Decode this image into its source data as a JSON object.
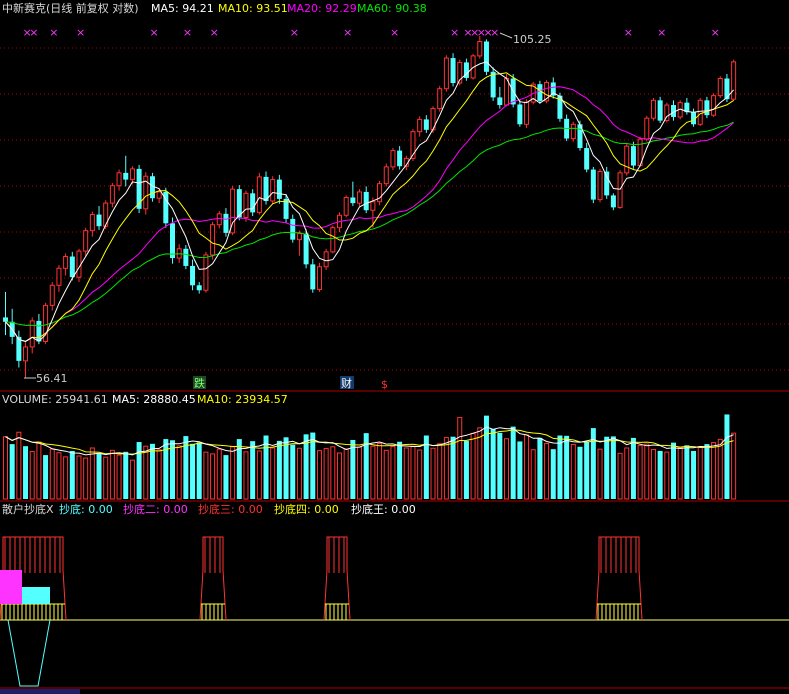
{
  "price_header": {
    "title": "中新赛克(日线 前复权 对数)",
    "ma5_label": "MA5: 94.21",
    "ma10_label": "MA10: 93.51",
    "ma20_label": "MA20: 92.29",
    "ma60_label": "MA60: 90.38"
  },
  "annotations": {
    "high_label": "105.25",
    "low_label": "56.41",
    "marker_die": "跌",
    "marker_cai": "财",
    "marker_dollar": "$"
  },
  "volume_header": {
    "volume_label": "VOLUME: 25941.61",
    "ma5_label": "MA5: 28880.45",
    "ma10_label": "MA10: 23934.57"
  },
  "indicator_header": {
    "name": "散户抄底X",
    "v1": "抄底: 0.00",
    "v2": "抄底二: 0.00",
    "v3": "抄底三: 0.00",
    "v4": "抄底四: 0.00",
    "v5": "抄底王: 0.00"
  },
  "colors": {
    "background": "#000000",
    "up": "#ff3232",
    "down": "#54ffff",
    "ma5": "#ffffff",
    "ma10": "#ffff00",
    "ma20": "#ff00ff",
    "ma60": "#00e600",
    "grid": "#b00000",
    "magenta_marker": "#ff33ff"
  },
  "chart_data": [
    {
      "type": "candlestick",
      "title": "中新赛克(日线 前复权 对数)",
      "ylim": [
        56.41,
        105.25
      ],
      "high": 105.25,
      "low": 56.41,
      "ohlc": [
        [
          63.0,
          66.0,
          61.0,
          62.5
        ],
        [
          62.5,
          64.0,
          60.0,
          60.8
        ],
        [
          60.8,
          61.5,
          57.5,
          58.2
        ],
        [
          58.2,
          60.2,
          56.4,
          59.7
        ],
        [
          59.7,
          63.0,
          59.0,
          62.6
        ],
        [
          62.6,
          63.4,
          60.0,
          60.3
        ],
        [
          60.3,
          64.7,
          60.0,
          64.4
        ],
        [
          64.4,
          67.2,
          63.8,
          66.8
        ],
        [
          66.8,
          69.3,
          66.0,
          68.9
        ],
        [
          68.9,
          70.8,
          68.0,
          70.4
        ],
        [
          70.4,
          71.0,
          67.4,
          67.8
        ],
        [
          67.8,
          71.4,
          67.2,
          71.1
        ],
        [
          71.1,
          74.2,
          70.5,
          73.8
        ],
        [
          73.8,
          76.4,
          73.0,
          76.0
        ],
        [
          76.0,
          77.2,
          73.9,
          74.4
        ],
        [
          74.4,
          78.0,
          74.0,
          77.6
        ],
        [
          77.6,
          80.5,
          77.0,
          80.1
        ],
        [
          80.1,
          82.5,
          79.4,
          82.0
        ],
        [
          82.0,
          84.6,
          80.0,
          81.0
        ],
        [
          81.0,
          83.0,
          80.3,
          82.6
        ],
        [
          82.6,
          83.2,
          76.2,
          76.8
        ],
        [
          76.8,
          82.1,
          76.0,
          81.5
        ],
        [
          81.5,
          82.0,
          77.8,
          78.3
        ],
        [
          78.3,
          79.6,
          77.6,
          79.2
        ],
        [
          79.2,
          79.8,
          74.2,
          74.8
        ],
        [
          74.8,
          75.6,
          69.5,
          70.2
        ],
        [
          70.2,
          72.0,
          69.6,
          71.4
        ],
        [
          71.4,
          71.9,
          68.8,
          69.2
        ],
        [
          69.2,
          70.0,
          66.2,
          66.8
        ],
        [
          66.8,
          67.2,
          65.8,
          66.2
        ],
        [
          66.2,
          71.0,
          65.9,
          70.6
        ],
        [
          70.6,
          75.0,
          70.0,
          74.6
        ],
        [
          74.6,
          76.5,
          74.1,
          76.1
        ],
        [
          76.1,
          76.9,
          73.0,
          73.5
        ],
        [
          73.5,
          80.1,
          73.2,
          79.6
        ],
        [
          79.6,
          80.2,
          75.2,
          75.6
        ],
        [
          75.6,
          79.4,
          75.0,
          79.0
        ],
        [
          79.0,
          79.6,
          75.8,
          76.3
        ],
        [
          76.3,
          82.0,
          76.0,
          81.4
        ],
        [
          81.4,
          82.2,
          77.4,
          77.9
        ],
        [
          77.9,
          81.5,
          77.5,
          81.0
        ],
        [
          81.0,
          81.7,
          77.5,
          78.2
        ],
        [
          78.2,
          78.9,
          74.9,
          75.4
        ],
        [
          75.4,
          76.0,
          72.2,
          72.6
        ],
        [
          72.6,
          73.8,
          70.5,
          73.4
        ],
        [
          73.4,
          74.0,
          68.9,
          69.4
        ],
        [
          69.4,
          70.1,
          65.9,
          66.3
        ],
        [
          66.3,
          69.6,
          66.0,
          69.1
        ],
        [
          69.1,
          71.4,
          68.7,
          71.0
        ],
        [
          71.0,
          74.5,
          70.8,
          74.2
        ],
        [
          74.2,
          76.3,
          73.6,
          75.9
        ],
        [
          75.9,
          78.7,
          75.6,
          78.4
        ],
        [
          78.4,
          80.7,
          77.2,
          77.6
        ],
        [
          77.6,
          79.6,
          77.2,
          79.2
        ],
        [
          79.2,
          80.0,
          76.2,
          76.6
        ],
        [
          76.6,
          78.4,
          74.2,
          77.8
        ],
        [
          77.8,
          80.8,
          77.3,
          80.4
        ],
        [
          80.4,
          83.4,
          80.0,
          82.9
        ],
        [
          82.9,
          85.8,
          82.4,
          85.4
        ],
        [
          85.4,
          86.1,
          82.5,
          83.0
        ],
        [
          83.0,
          84.6,
          82.4,
          84.2
        ],
        [
          84.2,
          88.8,
          83.8,
          88.4
        ],
        [
          88.4,
          90.9,
          87.6,
          90.4
        ],
        [
          90.4,
          91.1,
          88.2,
          88.7
        ],
        [
          88.7,
          92.6,
          88.2,
          92.2
        ],
        [
          92.2,
          96.1,
          91.7,
          95.6
        ],
        [
          95.6,
          101.6,
          95.1,
          101.1
        ],
        [
          101.1,
          102.0,
          96.0,
          96.6
        ],
        [
          96.6,
          100.8,
          96.2,
          100.3
        ],
        [
          100.3,
          101.0,
          97.0,
          97.5
        ],
        [
          97.5,
          101.9,
          97.2,
          101.5
        ],
        [
          101.5,
          105.25,
          101.0,
          104.2
        ],
        [
          104.2,
          104.6,
          98.0,
          98.6
        ],
        [
          98.6,
          99.4,
          93.5,
          94.1
        ],
        [
          94.1,
          95.9,
          92.2,
          92.8
        ],
        [
          92.8,
          98.2,
          92.6,
          97.4
        ],
        [
          97.4,
          98.2,
          92.4,
          92.9
        ],
        [
          92.9,
          93.6,
          89.2,
          89.6
        ],
        [
          89.6,
          93.8,
          89.0,
          93.3
        ],
        [
          93.3,
          96.8,
          92.9,
          96.4
        ],
        [
          96.4,
          97.0,
          93.0,
          93.5
        ],
        [
          93.5,
          97.1,
          93.1,
          96.7
        ],
        [
          96.7,
          97.6,
          93.9,
          94.4
        ],
        [
          94.4,
          94.9,
          90.0,
          90.5
        ],
        [
          90.5,
          91.2,
          86.9,
          87.3
        ],
        [
          87.3,
          90.0,
          86.8,
          89.6
        ],
        [
          89.6,
          90.2,
          85.4,
          85.8
        ],
        [
          85.8,
          86.6,
          82.1,
          82.5
        ],
        [
          82.5,
          82.9,
          77.6,
          78.1
        ],
        [
          78.1,
          82.6,
          77.7,
          82.2
        ],
        [
          82.2,
          82.9,
          78.2,
          78.7
        ],
        [
          78.7,
          79.0,
          76.6,
          77.0
        ],
        [
          77.0,
          82.4,
          76.8,
          82.0
        ],
        [
          82.0,
          86.6,
          81.6,
          86.1
        ],
        [
          86.1,
          86.8,
          82.6,
          83.1
        ],
        [
          83.1,
          87.6,
          82.9,
          87.2
        ],
        [
          87.2,
          91.0,
          86.8,
          90.6
        ],
        [
          90.6,
          94.0,
          90.2,
          93.6
        ],
        [
          93.6,
          94.2,
          89.8,
          90.2
        ],
        [
          90.2,
          93.2,
          89.9,
          92.8
        ],
        [
          92.8,
          93.6,
          90.2,
          90.8
        ],
        [
          90.8,
          93.6,
          90.4,
          93.2
        ],
        [
          93.2,
          94.0,
          91.2,
          91.6
        ],
        [
          91.6,
          92.2,
          89.2,
          89.6
        ],
        [
          89.6,
          94.0,
          89.3,
          93.6
        ],
        [
          93.6,
          94.2,
          90.6,
          91.1
        ],
        [
          91.1,
          94.8,
          90.8,
          94.4
        ],
        [
          94.4,
          97.8,
          94.0,
          97.4
        ],
        [
          97.4,
          98.2,
          93.3,
          93.8
        ],
        [
          93.8,
          100.8,
          93.5,
          100.4
        ]
      ],
      "ma_values": {
        "MA5": 94.21,
        "MA10": 93.51,
        "MA20": 92.29,
        "MA60": 90.38
      },
      "markers": [
        "跌",
        "财",
        "$"
      ]
    },
    {
      "type": "bar",
      "name": "VOLUME",
      "latest": 25941.61,
      "ma5": 28880.45,
      "ma10": 23934.57,
      "values": [
        21000,
        18500,
        22500,
        17800,
        16000,
        19200,
        14800,
        16800,
        15600,
        14200,
        16200,
        14500,
        13800,
        17200,
        15300,
        14100,
        16400,
        14800,
        15900,
        13100,
        19200,
        17800,
        18600,
        16600,
        20200,
        19800,
        17900,
        21200,
        18600,
        19100,
        15800,
        15200,
        16800,
        14800,
        17600,
        20200,
        15900,
        19500,
        16200,
        21400,
        17200,
        19600,
        20800,
        18300,
        17100,
        21800,
        22400,
        16300,
        17000,
        17600,
        15500,
        16900,
        19900,
        17500,
        22200,
        17800,
        18700,
        16400,
        17700,
        19300,
        17200,
        17800,
        16500,
        21400,
        17100,
        18600,
        20700,
        21000,
        27500,
        19600,
        22100,
        24000,
        28100,
        23600,
        22300,
        20300,
        24400,
        19400,
        21600,
        16600,
        20600,
        18700,
        16800,
        21400,
        21300,
        18400,
        17600,
        19300,
        23900,
        16800,
        21000,
        21100,
        15400,
        17200,
        20600,
        18000,
        18500,
        16700,
        16200,
        15800,
        19000,
        17400,
        18100,
        16200,
        17700,
        18500,
        19000,
        20100,
        28500,
        22200
      ],
      "up_flags": [
        1,
        0,
        1,
        0,
        1,
        1,
        0,
        1,
        1,
        1,
        0,
        1,
        1,
        1,
        0,
        1,
        1,
        1,
        0,
        1,
        0,
        1,
        0,
        1,
        0,
        0,
        1,
        0,
        0,
        0,
        1,
        1,
        1,
        0,
        1,
        0,
        1,
        0,
        1,
        0,
        1,
        0,
        0,
        0,
        1,
        0,
        0,
        1,
        1,
        1,
        1,
        1,
        0,
        1,
        0,
        1,
        1,
        1,
        1,
        0,
        1,
        1,
        1,
        0,
        1,
        1,
        1,
        0,
        1,
        0,
        1,
        1,
        0,
        0,
        0,
        1,
        0,
        0,
        1,
        1,
        0,
        1,
        0,
        0,
        0,
        1,
        0,
        0,
        0,
        1,
        0,
        0,
        1,
        1,
        0,
        1,
        1,
        1,
        0,
        1,
        0,
        1,
        0,
        0,
        1,
        0,
        1,
        1,
        0,
        1
      ]
    },
    {
      "type": "bar",
      "name": "散户抄底X",
      "values": {
        "抄底": 0.0,
        "抄底二": 0.0,
        "抄底三": 0.0,
        "抄底四": 0.0,
        "抄底王": 0.0
      }
    }
  ]
}
